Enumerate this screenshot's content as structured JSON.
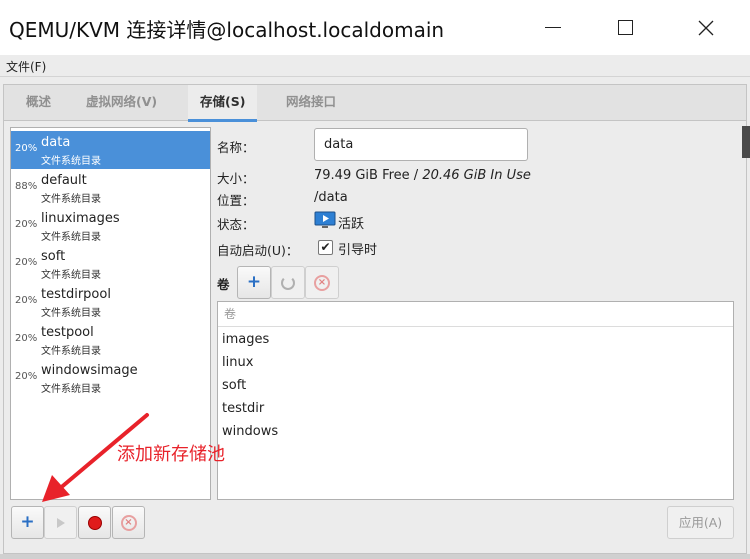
{
  "window": {
    "title": "QEMU/KVM 连接详情@localhost.localdomain"
  },
  "menu": {
    "file": "文件(F)"
  },
  "tabs": [
    {
      "label": "概述"
    },
    {
      "label": "虚拟网络(V)"
    },
    {
      "label": "存储(S)"
    },
    {
      "label": "网络接口"
    }
  ],
  "pools": [
    {
      "pct": "20%",
      "name": "data",
      "type": "文件系统目录"
    },
    {
      "pct": "88%",
      "name": "default",
      "type": "文件系统目录"
    },
    {
      "pct": "20%",
      "name": "linuximages",
      "type": "文件系统目录"
    },
    {
      "pct": "20%",
      "name": "soft",
      "type": "文件系统目录"
    },
    {
      "pct": "20%",
      "name": "testdirpool",
      "type": "文件系统目录"
    },
    {
      "pct": "20%",
      "name": "testpool",
      "type": "文件系统目录"
    },
    {
      "pct": "20%",
      "name": "windowsimage",
      "type": "文件系统目录"
    }
  ],
  "details": {
    "name_label": "名称：",
    "name_value": "data",
    "size_label": "大小：",
    "size_free": "79.49 GiB Free / ",
    "size_in_use": "20.46 GiB In Use",
    "location_label": "位置：",
    "location_value": "/data",
    "state_label": "状态：",
    "state_value": "活跃",
    "autostart_label": "自动启动(U)：",
    "autostart_value": "引导时",
    "autostart_checked": true
  },
  "volumes": {
    "label": "卷",
    "header": "卷",
    "items": [
      "images",
      "linux",
      "soft",
      "testdir",
      "windows"
    ]
  },
  "apply_label": "应用(A)",
  "annotation": "添加新存储池",
  "colors": {
    "accent": "#4a90d9",
    "annotation": "#e8222a"
  }
}
